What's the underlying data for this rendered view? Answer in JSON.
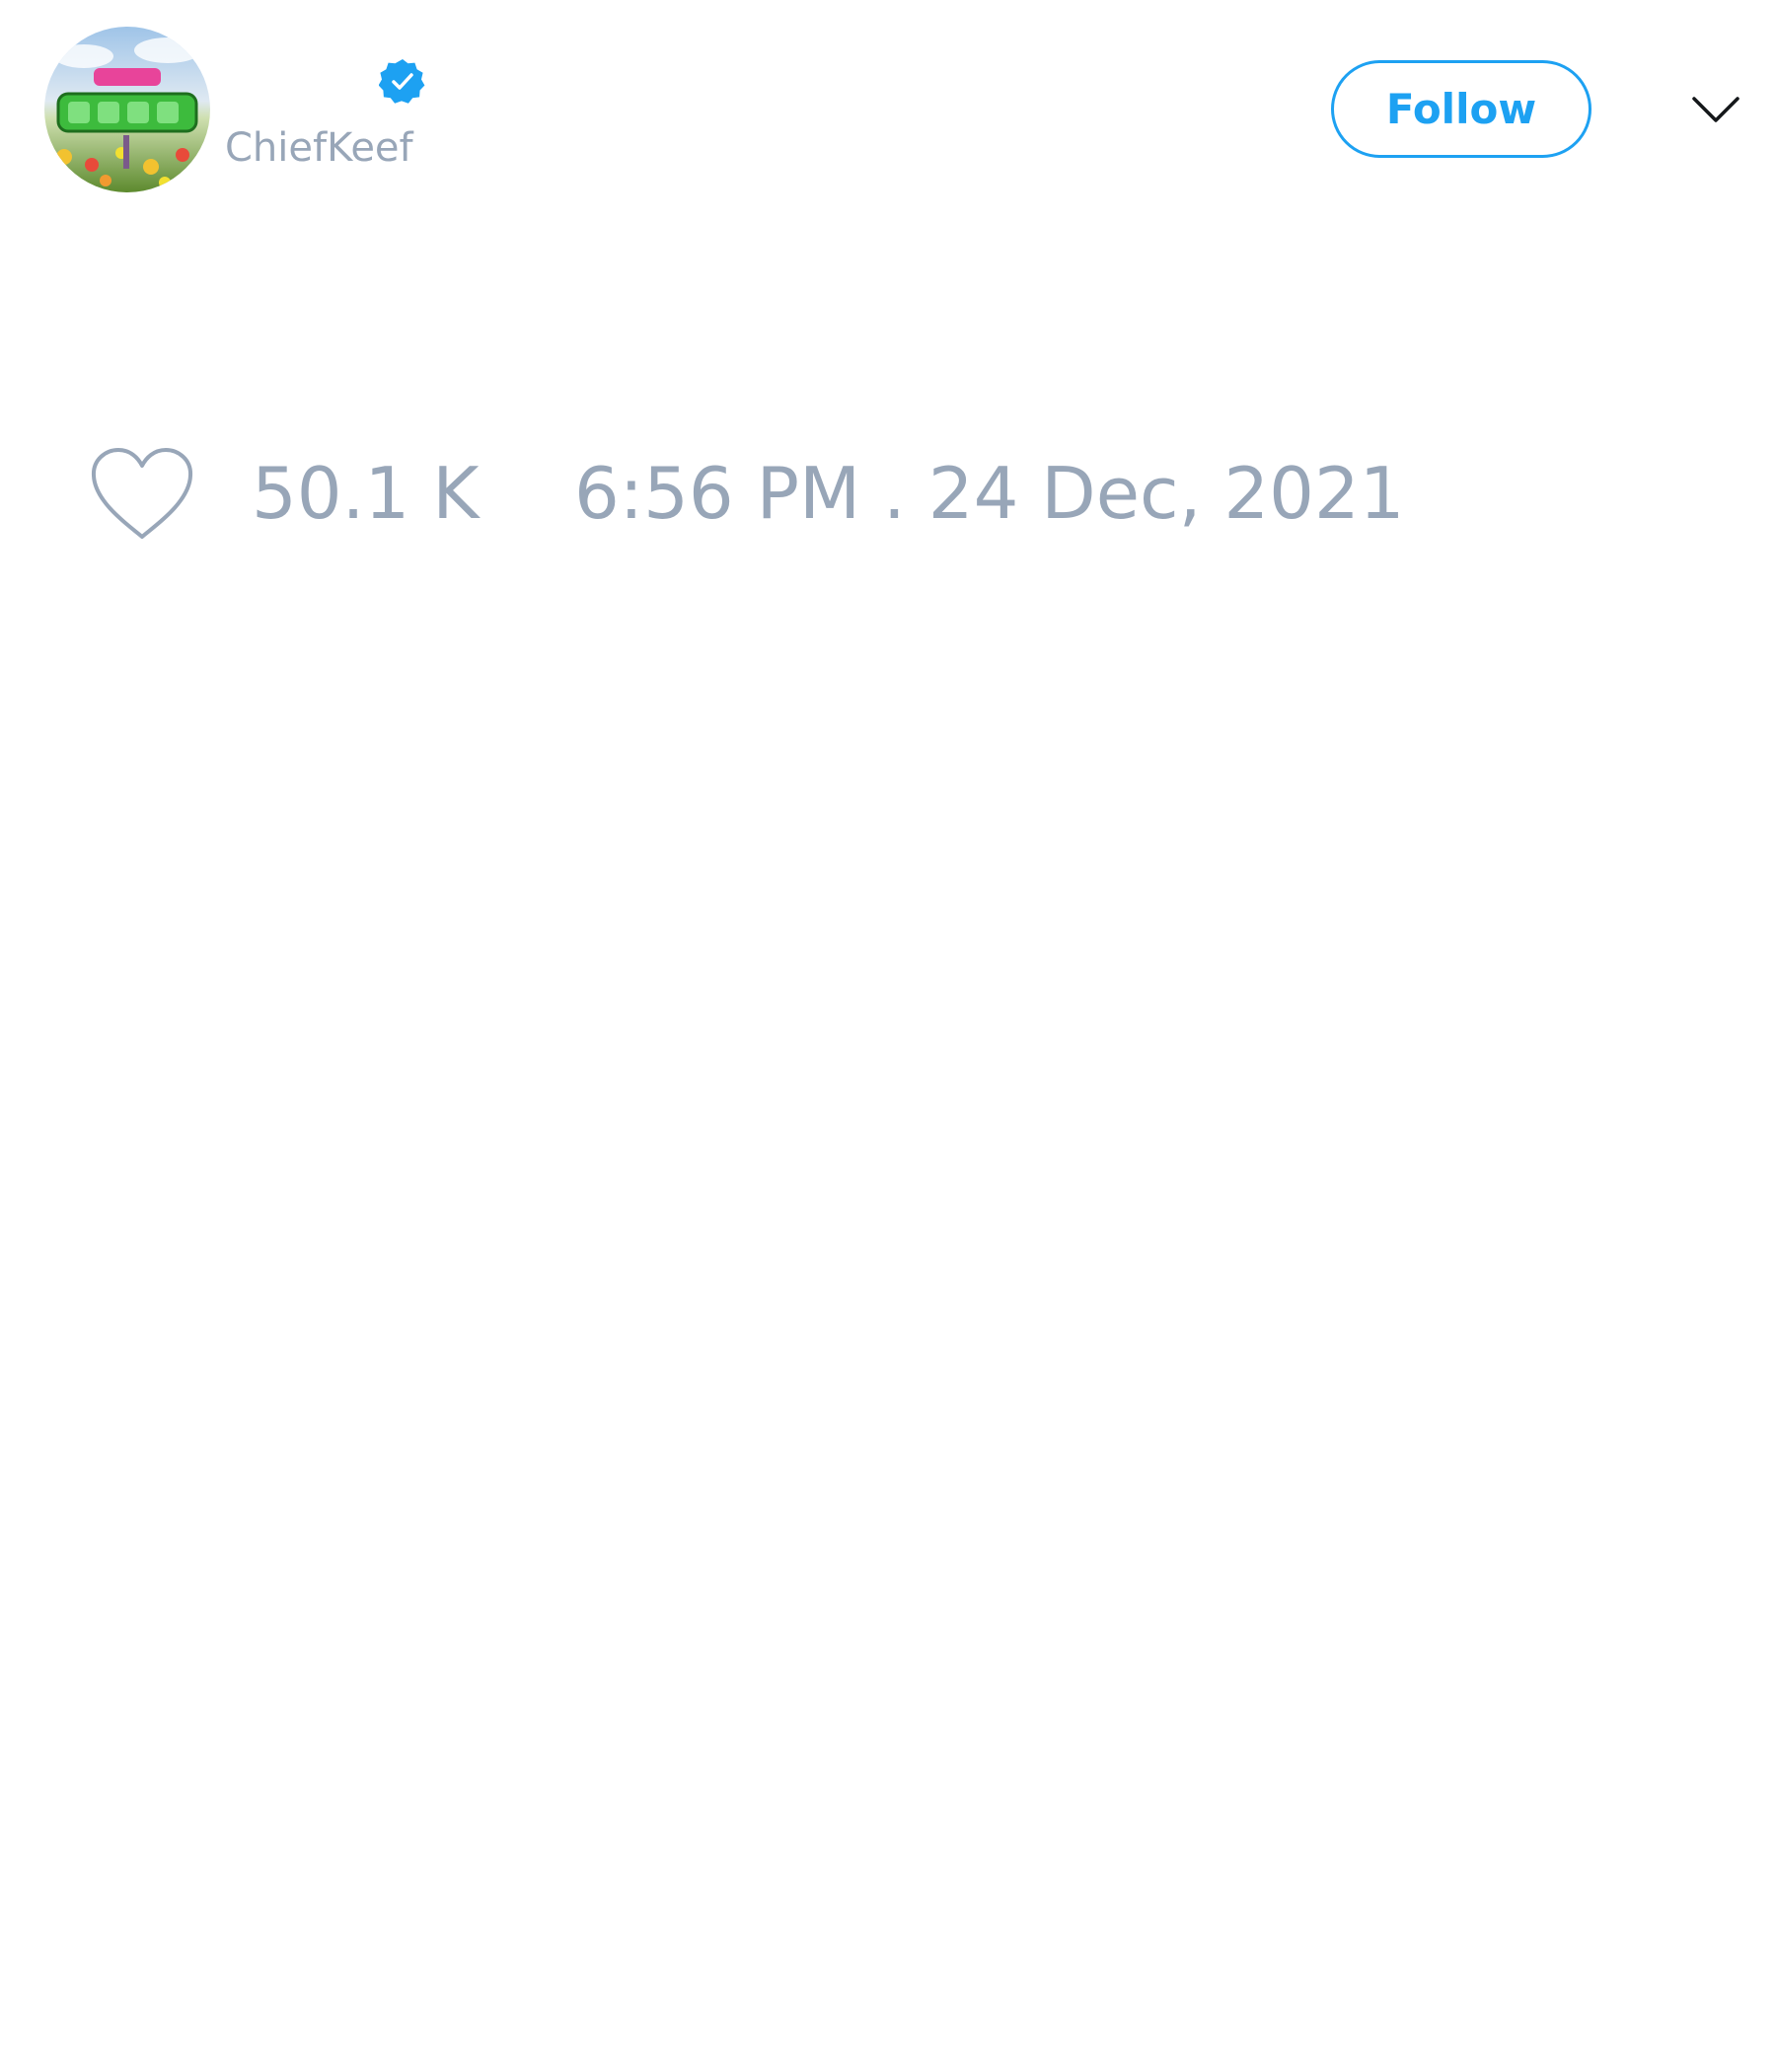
{
  "tweet": {
    "author": {
      "display_name": "",
      "handle": "ChiefKeef",
      "verified": true,
      "avatar_icon": "profile-picture"
    },
    "follow_label": "Follow",
    "menu_icon": "chevron-down-icon",
    "like_icon": "heart-outline-icon",
    "like_count": "50.1 K",
    "timestamp": "6:56 PM . 24 Dec, 2021"
  },
  "colors": {
    "accent": "#1da1f2",
    "muted_text": "#98a6b8",
    "background": "#ffffff"
  }
}
